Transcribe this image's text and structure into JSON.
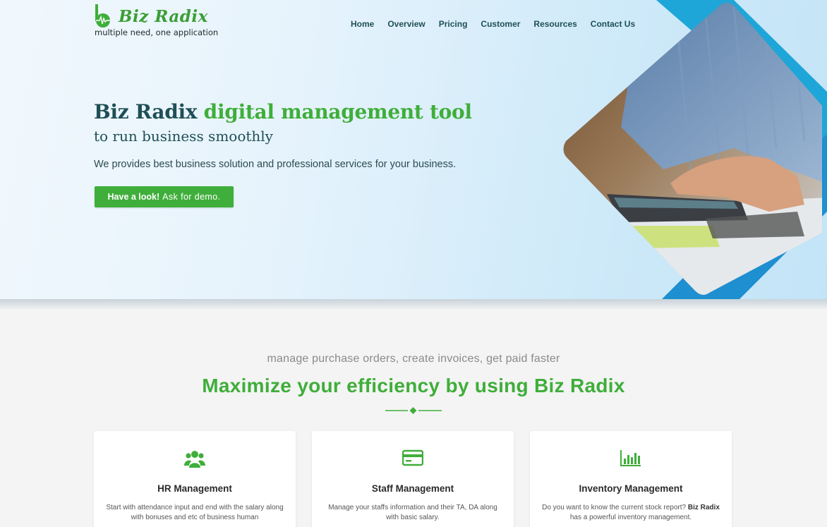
{
  "brand": {
    "name": "Biz Radix",
    "tagline": "multiple need, one application"
  },
  "nav": {
    "items": [
      "Home",
      "Overview",
      "Pricing",
      "Customer",
      "Resources",
      "Contact Us"
    ]
  },
  "hero": {
    "headline_plain": "Biz Radix",
    "headline_green": "digital management tool",
    "subline": "to run business smoothly",
    "description": "We provides best business solution and professional services for your business.",
    "cta_bold": "Have a look!",
    "cta_light": "Ask for demo."
  },
  "section": {
    "kicker": "manage purchase orders, create invoices, get paid faster",
    "title_a": "Maximize your",
    "title_b": "efficiency",
    "title_c": "by using Biz Radix"
  },
  "cards": [
    {
      "icon": "users-icon",
      "title": "HR Management",
      "text": "Start with attendance input and end with the salary along with bonuses and etc of business human"
    },
    {
      "icon": "credit-card-icon",
      "title": "Staff Management",
      "text": "Manage your staffs information and their TA, DA along with basic salary."
    },
    {
      "icon": "bar-chart-icon",
      "title": "Inventory Management",
      "text_a": "Do you want to know the current stock report?",
      "text_b": "Biz Radix",
      "text_c": "has a powerful inventory management."
    }
  ],
  "colors": {
    "brand_green": "#3fae3a",
    "heading_teal": "#1f4f56",
    "accent_blue": "#1ea5d9"
  }
}
